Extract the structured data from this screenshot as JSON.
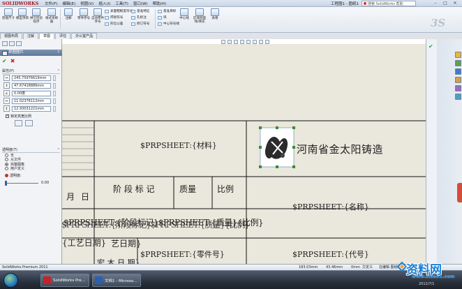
{
  "app": {
    "logo_text": "SOLIDWORKS",
    "document_title": "工程图1 - 图纸1",
    "product_text": "SolidWorks Premium 2011",
    "brand_mark": "3S"
  },
  "menu": [
    "文件(F)",
    "编辑(E)",
    "视图(V)",
    "插入(I)",
    "工具(T)",
    "窗口(W)",
    "帮助(H)"
  ],
  "search": {
    "placeholder": "搜索 SolidWorks 帮助"
  },
  "ribbon": {
    "buttons": [
      "智能尺寸",
      "模型项目",
      "拼写检验程序",
      "格式涂刷器",
      "注解",
      "零件序号",
      "自动零件序号",
      "表面粗糙度符号",
      "焊接符号",
      "形位公差",
      "基准特征",
      "孔标注",
      "修订符号"
    ],
    "small": [
      "基准目标",
      "块",
      "中心符号线",
      "中心线",
      "区域剖面线/填充",
      "表格"
    ]
  },
  "panel_tabs": [
    "视图布局",
    "注解",
    "草图",
    "评估",
    "办公室产品"
  ],
  "property_manager": {
    "title": "草图图片",
    "help": "?",
    "properties_label": "属性(P)",
    "fields": [
      "245.75976619mm",
      "47.67418886mm",
      "0.00度",
      "11.02376112mm",
      "12.93031221mm"
    ],
    "lock_aspect": "锁定高宽比例",
    "transparency_label": "透明度(T)",
    "radio_options": [
      "无",
      "从文件",
      "完整图像",
      "用户定义"
    ],
    "selected_radio": 2,
    "slider_label": "透明度:",
    "slider_value": "0.00"
  },
  "titleblock": {
    "material": "$PRPSHEET:{材料}",
    "company": "河南省金太阳铸造",
    "col_month": "月",
    "col_day": "日",
    "col_stage": "阶 段 标 记",
    "col_mass": "质量",
    "col_scale": "比例",
    "name": "$PRPSHEET:{名称}",
    "partno": "$PRPSHEET:{零件号}",
    "code": "$PRPSHEET:{代号}",
    "overlap_row1": "$PRPSHEET:{阶段标记}$PRPSHEET:{质量}{比例}",
    "overlap_row2": "艺日期}",
    "overlap_row3": "宏 木 日 期}",
    "overlap_left": "{工艺日期}"
  },
  "status": {
    "left": "SolidWorks Premium 2011",
    "x": "183.03mm",
    "y": "43.46mm",
    "z": "0mm",
    "state": "欠定义",
    "editing": "在编辑 图纸1"
  },
  "taskbar": {
    "tasks": [
      "SolidWorks Pre...",
      "文档1 - Microso..."
    ],
    "time": "2012/7/1"
  },
  "watermark": {
    "text": "资料网",
    "url": "www.ziliao1.com"
  },
  "colors": {
    "accent": "#5e7899",
    "sheet": "#eae7dc",
    "ok": "#2a9a2e",
    "cancel": "#c92a2a"
  }
}
